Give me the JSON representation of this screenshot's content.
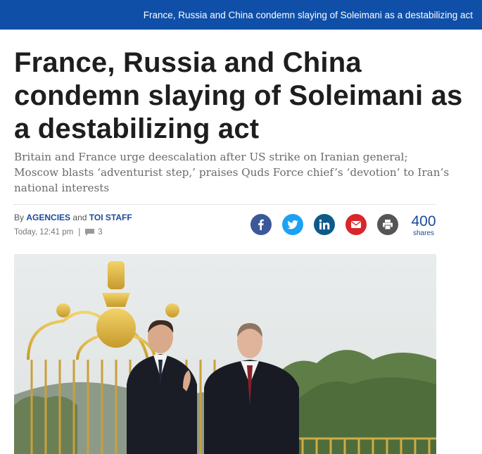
{
  "topbar": {
    "title": "France, Russia and China condemn slaying of Soleimani as a destabilizing act"
  },
  "article": {
    "headline": "France, Russia and China condemn slaying of Soleimani as a destabilizing act",
    "subheadline": "Britain and France urge deescalation after US strike on Iranian general; Moscow blasts ‘adventurist step,’ praises Quds Force chief’s ‘devotion’ to Iran’s national interests",
    "byline": {
      "prefix": "By",
      "author1": "AGENCIES",
      "conjunction": "and",
      "author2": "TOI STAFF"
    },
    "timestamp": "Today, 12:41 pm",
    "separator": "|",
    "comment_count": "3"
  },
  "share": {
    "buttons": [
      {
        "name": "facebook",
        "icon": "facebook-icon",
        "color": "#3b5998"
      },
      {
        "name": "twitter",
        "icon": "twitter-icon",
        "color": "#1da1f2"
      },
      {
        "name": "linkedin",
        "icon": "linkedin-icon",
        "color": "#0e5a8a"
      },
      {
        "name": "email",
        "icon": "mail-icon",
        "color": "#d9262b"
      },
      {
        "name": "print",
        "icon": "printer-icon",
        "color": "#555555"
      }
    ],
    "count": "400",
    "label": "shares"
  },
  "colors": {
    "topbar": "#0f4fa8",
    "accent": "#1a4a9c"
  }
}
